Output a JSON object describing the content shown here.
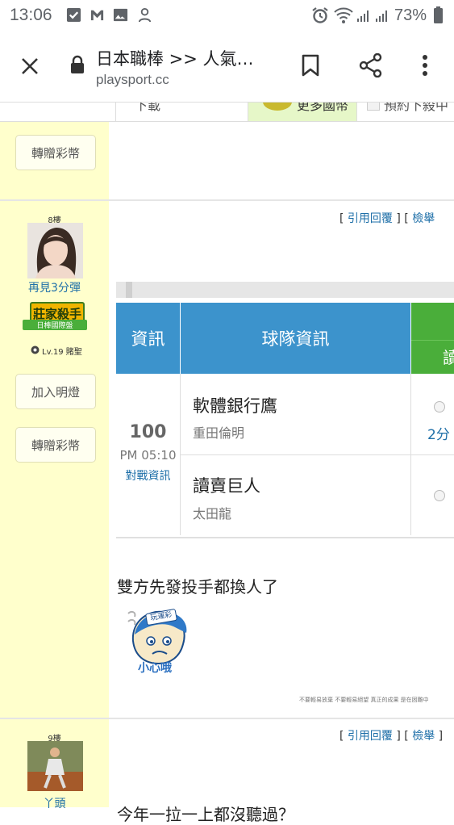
{
  "status_bar": {
    "time": "13:06",
    "battery": "73%",
    "icons": [
      "check-box-icon",
      "gmail-icon",
      "image-icon",
      "person-icon",
      "alarm-icon",
      "wifi-icon",
      "signal-icon",
      "signal-icon",
      "battery-icon"
    ]
  },
  "browser": {
    "title": "日本職棒 >> 人氣…",
    "domain": "playsport.cc"
  },
  "top_partial": {
    "text_a": "下載",
    "text_b": "更多國幣",
    "text_c": "預約下殺中"
  },
  "post8": {
    "floor": "8樓",
    "username": "再見3分彈",
    "badge_main": "莊家殺手",
    "badge_sub": "日棒國際盤",
    "level": "Lv.19 賭聖",
    "follow_button": "加入明燈",
    "gift_button": "轉贈彩幣",
    "quote_link": "引用回覆",
    "report_link": "檢舉",
    "table": {
      "col_info": "資訊",
      "col_team": "球隊資訊",
      "col_partial": "讀",
      "game_no": "100",
      "game_time": "PM 05:10",
      "matchup_link": "對戰資訊",
      "away_team": "軟體銀行鷹",
      "away_pitcher": "重田倫明",
      "home_team": "讀賣巨人",
      "home_pitcher": "太田龍",
      "spread": "2分"
    },
    "message": "雙方先發投手都換人了",
    "sticker_text": "小心哦",
    "sticker_tag": "玩運彩",
    "signature": "不要輕易放棄 不要輕易絕望 真正的成果 是在困難中"
  },
  "prev_post": {
    "gift_button": "轉贈彩幣"
  },
  "post9": {
    "floor": "9樓",
    "username": "丫頭",
    "quote_link": "引用回覆",
    "report_link": "檢舉",
    "message_partial": "今年一拉一上都沒聽過？"
  },
  "colors": {
    "left_column_bg": "#ffffcc",
    "header_blue": "#3c93cc",
    "header_green": "#4aae3a",
    "link_blue": "#1e6fa8"
  }
}
